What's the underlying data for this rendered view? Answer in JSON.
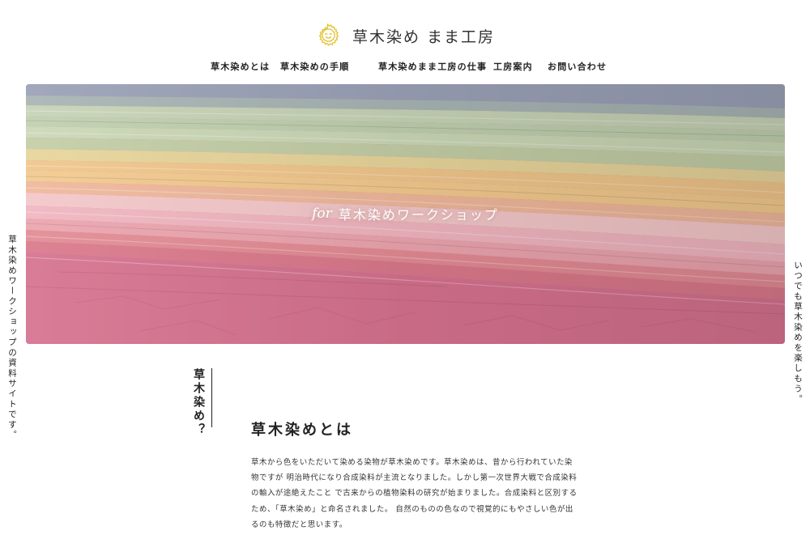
{
  "header": {
    "logo_text": "草木染め まま工房",
    "logo_icon": "smiling-sun-icon",
    "accent_color": "#e3c02e"
  },
  "nav": {
    "items": [
      {
        "label": "草木染めとは"
      },
      {
        "label": "草木染めの手順"
      },
      {
        "label": "草木染めまま工房の仕事"
      },
      {
        "label": "工房案内"
      },
      {
        "label": "お問い合わせ"
      }
    ]
  },
  "hero": {
    "prefix": "for",
    "title": "草木染めワークショップ",
    "image": "stacked plant-dyed cloth"
  },
  "side": {
    "left": "草木染めワークショップの資料サイトです。",
    "right": "いつでも草木染めを楽しもう。"
  },
  "section": {
    "label": "草木染め？",
    "heading": "草木染めとは",
    "lines": [
      "草木から色をいただいて染める染物が草木染めです。草木染めは、昔から行われていた染",
      "物ですが 明治時代になり合成染料が主流となりました。しかし第一次世界大戦で合成染料",
      "の輸入が途絶えたこと で古来からの植物染料の研究が始まりました。合成染料と区別する",
      "ため、「草木染め」と命名されました。 自然のものの色なので視覚的にもやさしい色が出",
      "るのも特徴だと思います。"
    ]
  }
}
